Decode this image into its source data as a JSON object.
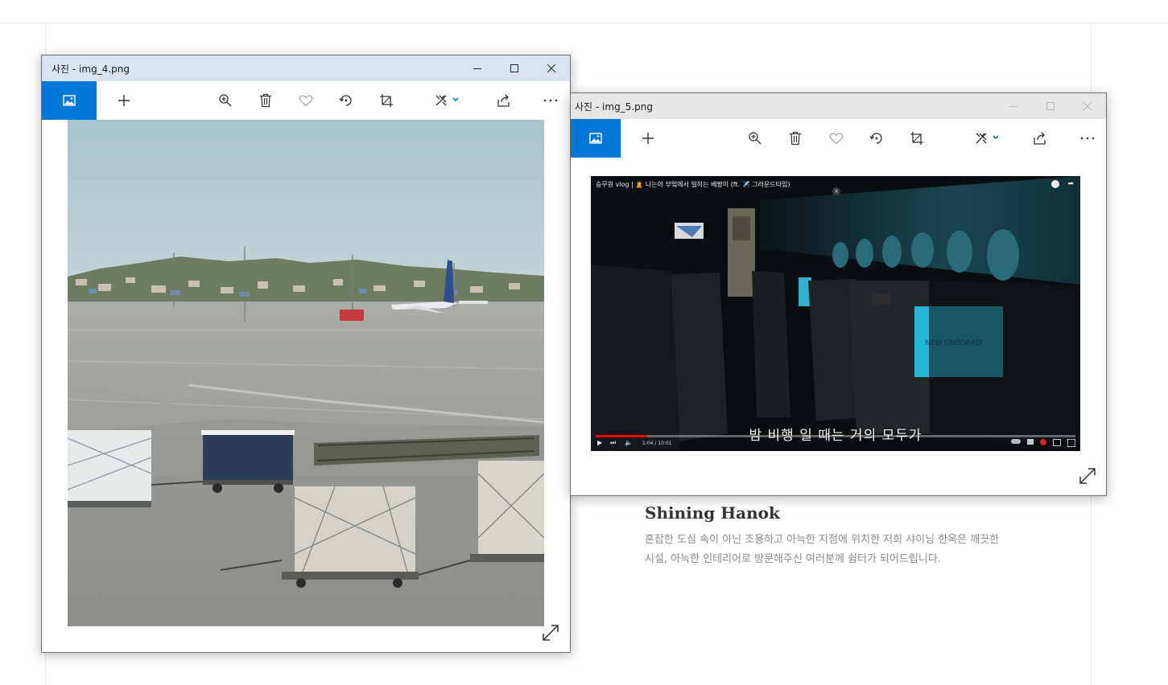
{
  "background_page": {
    "title": "Shining Hanok",
    "description_line1": "혼잡한 도심 속이 아닌 조용하고 아늑한 지점에 위치한 저희 샤이닝 한옥은 깨끗한",
    "description_line2": "시설, 아늑한 인테리어로 방문해주신 여러분께 쉼터가 되어드립니다."
  },
  "windows": [
    {
      "title": "사진 - img_4.png",
      "active": true,
      "toolbar_icons": [
        "photos-home-icon",
        "add-icon",
        "zoom-icon",
        "delete-icon",
        "favorite-icon",
        "rotate-icon",
        "crop-icon",
        "edit-icon",
        "share-icon",
        "more-icon"
      ],
      "content": "airport apron photo"
    },
    {
      "title": "사진 - img_5.png",
      "active": false,
      "toolbar_icons": [
        "photos-home-icon",
        "add-icon",
        "zoom-icon",
        "delete-icon",
        "favorite-icon",
        "rotate-icon",
        "crop-icon",
        "edit-icon",
        "share-icon",
        "more-icon"
      ],
      "video": {
        "top_title": "승무원 vlog | 🙎 나는야 부엌에서 일하는 베짱이 (ft. ✈️ 그라운드타임)",
        "subtitle": "밤 비행 일 때는 거의 모두가",
        "time": "1:04 / 10:01",
        "progress": 0.107,
        "screen_text": "NEW ONBOARD"
      }
    }
  ],
  "colors": {
    "accent": "#0078d7",
    "active_titlebar": "#dae3f1",
    "inactive_titlebar": "#e6e6e6"
  }
}
